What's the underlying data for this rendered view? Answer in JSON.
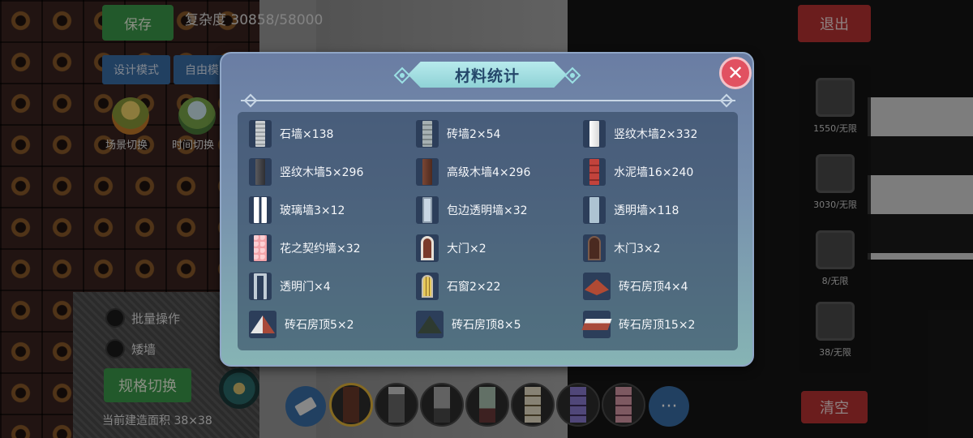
{
  "hud": {
    "save_label": "保存",
    "complexity_text": "复杂度 30858/58000",
    "design_mode_label": "设计模式",
    "free_mode_label": "自由模",
    "scene_switch_label": "场景切换",
    "time_switch_label": "时间切换",
    "batch_operation_label": "批量操作",
    "low_wall_label": "矮墙",
    "spec_switch_label": "规格切换",
    "build_area_label": "当前建造面积 38×38",
    "exit_label": "退出",
    "clear_label": "清空"
  },
  "side_items": [
    {
      "count": "1550/无限",
      "icon": "wall-block-icon"
    },
    {
      "count": "3030/无限",
      "icon": "floor-block-icon"
    },
    {
      "count": "8/无限",
      "icon": "window-block-icon"
    },
    {
      "count": "38/无限",
      "icon": "stair-block-icon"
    }
  ],
  "toolbar": {
    "more_label": "···"
  },
  "modal": {
    "title": "材料统计",
    "close_symbol": "✕",
    "materials": [
      {
        "label": "石墙×138",
        "icon": "stone-wall-icon",
        "color": "#b8bcc0"
      },
      {
        "label": "砖墙2×54",
        "icon": "brick-wall-icon",
        "color": "#9aa6a8"
      },
      {
        "label": "竖纹木墙2×332",
        "icon": "vertical-wood-wall-icon",
        "color": "#f0f0f0"
      },
      {
        "label": "竖纹木墙5×296",
        "icon": "vertical-wood-wall-icon",
        "color": "#4a4a4e"
      },
      {
        "label": "高级木墙4×296",
        "icon": "premium-wood-wall-icon",
        "color": "#6a3a2a"
      },
      {
        "label": "水泥墙16×240",
        "icon": "cement-wall-icon",
        "color": "#b33a34"
      },
      {
        "label": "玻璃墙3×12",
        "icon": "glass-wall-icon",
        "color": "#ffffff"
      },
      {
        "label": "包边透明墙×32",
        "icon": "framed-transparent-wall-icon",
        "color": "#c8d6e4"
      },
      {
        "label": "透明墙×118",
        "icon": "transparent-wall-icon",
        "color": "#b0c6d4"
      },
      {
        "label": "花之契约墙×32",
        "icon": "flower-contract-wall-icon",
        "color": "#f1a3a9"
      },
      {
        "label": "大门×2",
        "icon": "gate-icon",
        "color": "#7a3a2a"
      },
      {
        "label": "木门3×2",
        "icon": "wooden-door-icon",
        "color": "#4a2a20"
      },
      {
        "label": "透明门×4",
        "icon": "transparent-door-icon",
        "color": "#c0ccd6"
      },
      {
        "label": "石窗2×22",
        "icon": "stone-window-icon",
        "color": "#d7b64a"
      },
      {
        "label": "砖石房顶4×4",
        "icon": "brick-roof-icon",
        "color": "#b04a34"
      },
      {
        "label": "砖石房顶5×2",
        "icon": "brick-roof-icon",
        "color": "#e6e6e6"
      },
      {
        "label": "砖石房顶8×5",
        "icon": "brick-roof-icon",
        "color": "#2e3a30"
      },
      {
        "label": "砖石房顶15×2",
        "icon": "brick-roof-icon",
        "color": "#a84a3a"
      }
    ]
  }
}
